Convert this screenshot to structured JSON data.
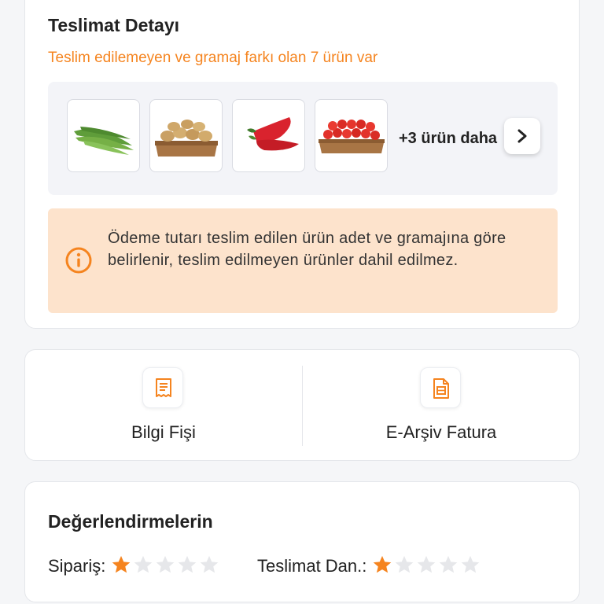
{
  "delivery": {
    "title": "Teslimat Detayı",
    "subtitle": "Teslim edilemeyen ve gramaj farkı olan 7 ürün var",
    "products": [
      {
        "name": "green-beans"
      },
      {
        "name": "potatoes"
      },
      {
        "name": "red-pepper"
      },
      {
        "name": "cherry-tomatoes"
      }
    ],
    "more_label": "+3 ürün daha",
    "next_icon": "chevron-right-icon",
    "info_icon": "info-circle-icon",
    "info_text": "Ödeme tutarı teslim edilen ürün adet ve gramajına göre belirlenir, teslim edilmeyen ürünler dahil edilmez."
  },
  "documents": {
    "items": [
      {
        "label": "Bilgi Fişi",
        "icon": "receipt-icon"
      },
      {
        "label": "E-Arşiv Fatura",
        "icon": "invoice-icon"
      }
    ]
  },
  "ratings": {
    "title": "Değerlendirmelerin",
    "order": {
      "label": "Sipariş:",
      "score": 1,
      "max": 5
    },
    "delivery": {
      "label": "Teslimat Dan.:",
      "score": 1,
      "max": 5
    }
  },
  "colors": {
    "accent": "#f5841f",
    "info_bg": "#fde3cc",
    "star_filled": "#f5841f",
    "star_empty": "#e6e7ea"
  }
}
